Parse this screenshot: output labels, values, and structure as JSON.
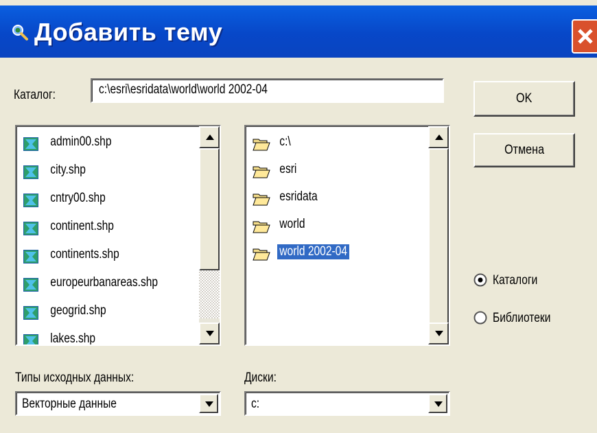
{
  "window": {
    "title": "Добавить тему"
  },
  "catalog": {
    "label": "Каталог:",
    "path": "c:\\esri\\esridata\\world\\world 2002-04"
  },
  "buttons": {
    "ok": "OK",
    "cancel": "Отмена"
  },
  "files": [
    {
      "name": "admin00.shp",
      "icon": "shapefile-icon"
    },
    {
      "name": "city.shp",
      "icon": "shapefile-icon"
    },
    {
      "name": "cntry00.shp",
      "icon": "shapefile-icon"
    },
    {
      "name": "continent.shp",
      "icon": "shapefile-icon"
    },
    {
      "name": "continents.shp",
      "icon": "shapefile-icon"
    },
    {
      "name": "europeurbanareas.shp",
      "icon": "shapefile-icon"
    },
    {
      "name": "geogrid.shp",
      "icon": "shapefile-icon"
    },
    {
      "name": "lakes.shp",
      "icon": "shapefile-icon"
    }
  ],
  "folders": [
    {
      "name": "c:\\",
      "icon": "open-folder-icon",
      "selected": false
    },
    {
      "name": "esri",
      "icon": "open-folder-icon",
      "selected": false
    },
    {
      "name": "esridata",
      "icon": "open-folder-icon",
      "selected": false
    },
    {
      "name": "world",
      "icon": "open-folder-icon",
      "selected": false
    },
    {
      "name": "world 2002-04",
      "icon": "open-folder-icon",
      "selected": true
    }
  ],
  "source_type": {
    "label": "Типы исходных данных:",
    "value": "Векторные данные"
  },
  "drives": {
    "label": "Диски:",
    "value": "c:"
  },
  "view_mode": {
    "options": [
      {
        "label": "Каталоги",
        "checked": true
      },
      {
        "label": "Библиотеки",
        "checked": false
      }
    ]
  },
  "colors": {
    "title_bar": "#0747c8",
    "selection": "#316ac5",
    "dialog_bg": "#ece9d8",
    "close_button": "#d9512c"
  }
}
